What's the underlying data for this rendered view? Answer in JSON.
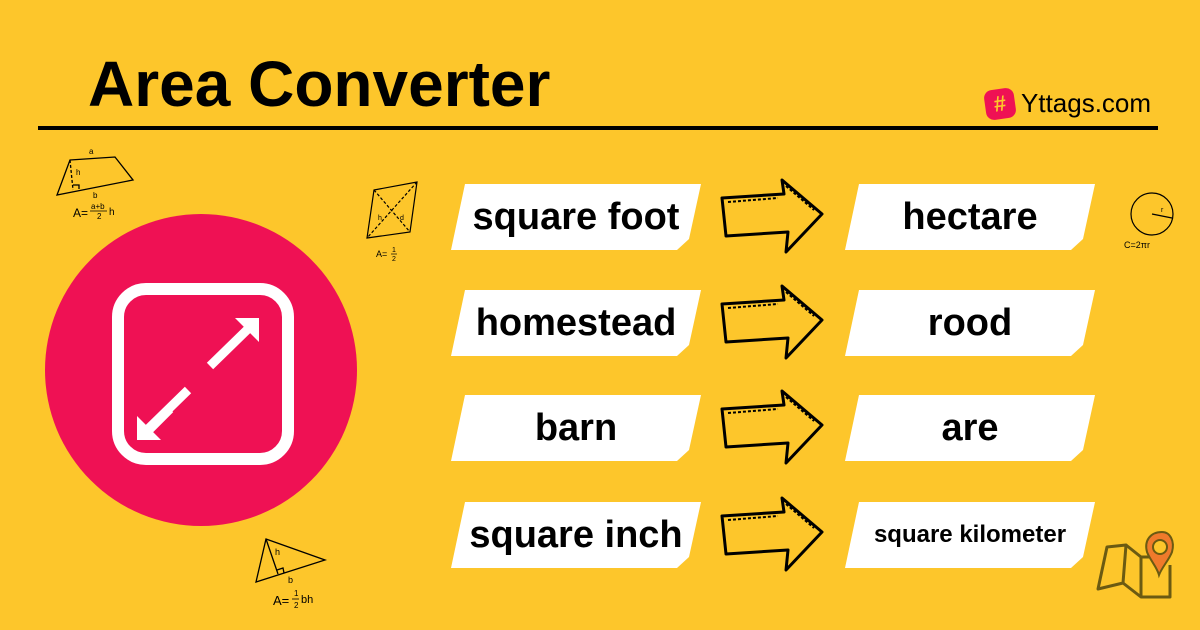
{
  "header": {
    "title": "Area Converter",
    "brand": {
      "icon": "hash-icon",
      "glyph": "#",
      "name": "Yttags.com"
    }
  },
  "colors": {
    "background": "#FDC62B",
    "accent": "#EF1154",
    "pin": "#F07A2B"
  },
  "hero_icon": "resize-diagonal-icon",
  "conversions": [
    {
      "from": "square foot",
      "to": "hectare"
    },
    {
      "from": "homestead",
      "to": "rood"
    },
    {
      "from": "barn",
      "to": "are"
    },
    {
      "from": "square inch",
      "to": "square kilometer"
    }
  ],
  "sketches": {
    "trapezoid": {
      "top": "a",
      "height": "h",
      "base": "b",
      "formula": "A = (a+b)/2 h"
    },
    "rhombus": {
      "d1": "h",
      "d2": "d",
      "formula": "A = 1/2"
    },
    "circle": {
      "radius": "r",
      "formula": "C=2πr"
    },
    "triangle": {
      "height": "h",
      "base": "b",
      "formula": "A = 1/2 bh"
    }
  }
}
